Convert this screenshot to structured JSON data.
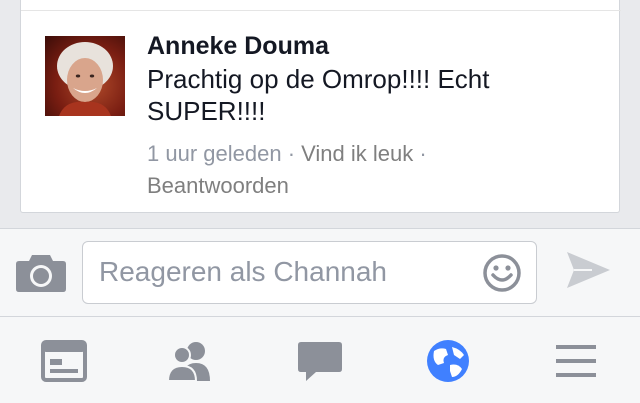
{
  "comment": {
    "author": "Anneke Douma",
    "text": "Prachtig op de Omrop!!!! Echt SUPER!!!!",
    "time": "1 uur geleden",
    "separator": " · ",
    "like_label": "Vind ik leuk",
    "reply_label": "Beantwoorden"
  },
  "composer": {
    "placeholder": "Reageren als Channah"
  },
  "tabs": [
    {
      "icon": "news-feed-icon",
      "active": false
    },
    {
      "icon": "friends-icon",
      "active": false
    },
    {
      "icon": "messages-icon",
      "active": false
    },
    {
      "icon": "globe-icon",
      "active": true
    },
    {
      "icon": "menu-icon",
      "active": false
    }
  ],
  "colors": {
    "text_primary": "#141823",
    "text_secondary": "#9197a3",
    "icon_gray": "#8c9099",
    "accent_blue": "#4080ff"
  }
}
